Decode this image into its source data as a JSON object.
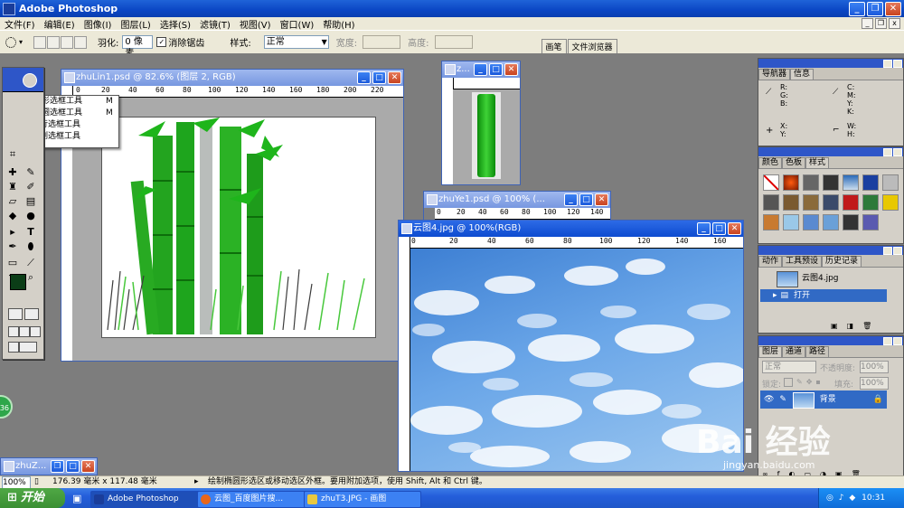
{
  "app": {
    "title": "Adobe Photoshop"
  },
  "menubar": {
    "items": [
      "文件(F)",
      "编辑(E)",
      "图像(I)",
      "图层(L)",
      "选择(S)",
      "滤镜(T)",
      "视图(V)",
      "窗口(W)",
      "帮助(H)"
    ]
  },
  "options": {
    "feather_label": "羽化:",
    "feather_value": "0 像素",
    "antialias_label": "消除锯齿",
    "style_label": "样式:",
    "style_value": "正常",
    "width_label": "宽度:",
    "height_label": "高度:",
    "tab_brush": "画笔",
    "tab_browser": "文件浏览器"
  },
  "flyout": {
    "items": [
      {
        "mark": "",
        "label": "矩形选框工具",
        "shortcut": "M"
      },
      {
        "mark": "■",
        "label": "椭圆选框工具",
        "shortcut": "M"
      },
      {
        "mark": "",
        "label": "单行选框工具",
        "shortcut": ""
      },
      {
        "mark": "",
        "label": "单列选框工具",
        "shortcut": ""
      }
    ]
  },
  "windows": {
    "zhulin": {
      "title": "zhuLin1.psd @ 82.6% (图层 2, RGB)",
      "ruler": [
        "0",
        "20",
        "40",
        "60",
        "80",
        "100",
        "120",
        "140",
        "160",
        "180",
        "200",
        "220"
      ]
    },
    "small": {
      "title": "z..."
    },
    "zhuye": {
      "title": "zhuYe1.psd @ 100% (...",
      "ruler": [
        "0",
        "20",
        "40",
        "60",
        "80",
        "100",
        "120",
        "140"
      ]
    },
    "yuntu": {
      "title": "云图4.jpg @ 100%(RGB)",
      "ruler": [
        "0",
        "20",
        "40",
        "60",
        "80",
        "100",
        "120",
        "140",
        "160"
      ]
    },
    "minimized": {
      "title": "zhuZ..."
    }
  },
  "palettes": {
    "navigator": {
      "tabs": [
        "导航器",
        "信息"
      ],
      "labels": [
        "R:",
        "G:",
        "B:",
        "C:",
        "M:",
        "Y:",
        "K:",
        "X:",
        "Y:",
        "W:",
        "H:"
      ]
    },
    "color": {
      "tabs": [
        "颜色",
        "色板",
        "样式"
      ]
    },
    "history": {
      "tabs": [
        "动作",
        "工具预设",
        "历史记录"
      ],
      "snapshot": "云图4.jpg",
      "step": "打开"
    },
    "layers": {
      "tabs": [
        "图层",
        "通道",
        "路径"
      ],
      "blend": "正常",
      "opacity_label": "不透明度:",
      "opacity": "100%",
      "lock_label": "锁定:",
      "fill_label": "填充:",
      "fill": "100%",
      "layer_name": "背景"
    }
  },
  "status": {
    "zoom": "100%",
    "size": "176.39 毫米 x 117.48 毫米",
    "hint": "绘制椭圆形选区或移动选区外框。要用附加选项，使用 Shift, Alt 和 Ctrl 键。"
  },
  "taskbar": {
    "start": "开始",
    "tasks": [
      "Adobe Photoshop",
      "云图_百度图片搜...",
      "zhuT3.JPG - 画图"
    ],
    "clock": "10:31"
  },
  "watermark": {
    "brand": "Bai 经验",
    "url": "jingyan.baidu.com"
  },
  "badge": "36"
}
